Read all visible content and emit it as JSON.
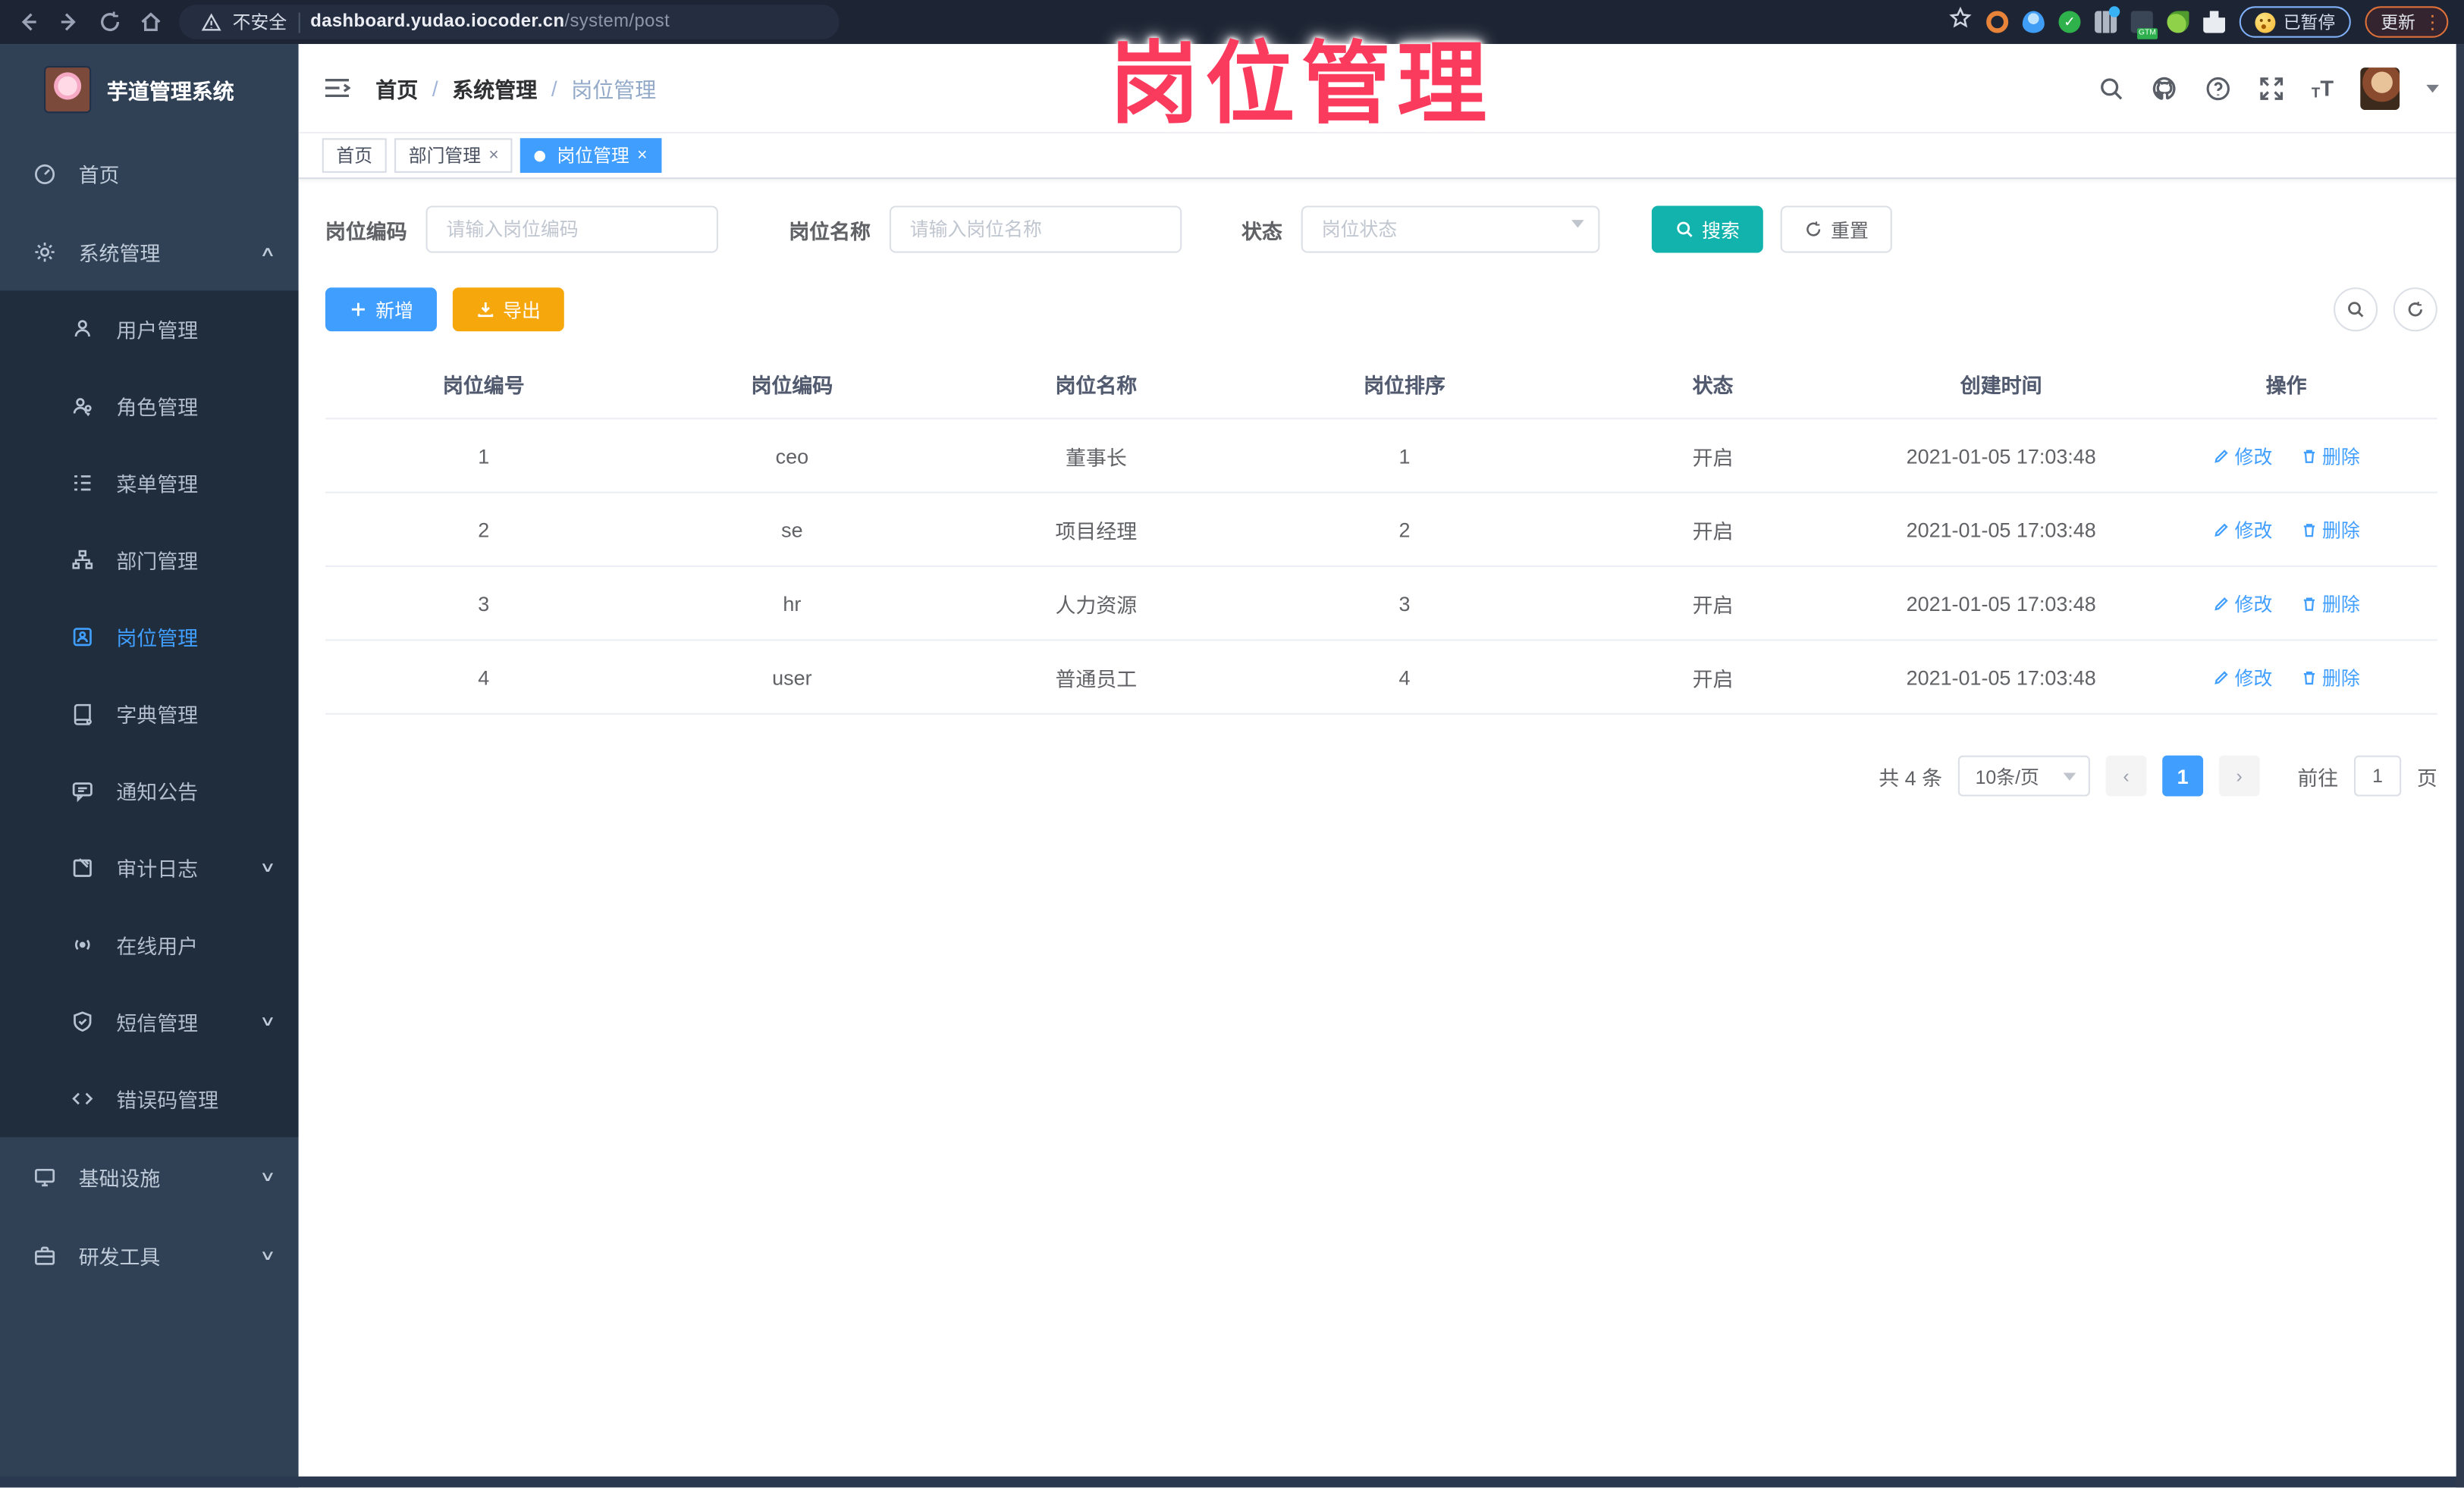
{
  "browser": {
    "security_label": "不安全",
    "url_host": "dashboard.yudao.iocoder.cn",
    "url_path": "/system/post",
    "paused_badge": "已暂停",
    "update_button": "更新"
  },
  "watermark": "岗位管理",
  "sidebar": {
    "app_title": "芋道管理系统",
    "items": [
      {
        "label": "首页"
      },
      {
        "label": "系统管理"
      },
      {
        "label": "用户管理"
      },
      {
        "label": "角色管理"
      },
      {
        "label": "菜单管理"
      },
      {
        "label": "部门管理"
      },
      {
        "label": "岗位管理"
      },
      {
        "label": "字典管理"
      },
      {
        "label": "通知公告"
      },
      {
        "label": "审计日志"
      },
      {
        "label": "在线用户"
      },
      {
        "label": "短信管理"
      },
      {
        "label": "错误码管理"
      },
      {
        "label": "基础设施"
      },
      {
        "label": "研发工具"
      }
    ]
  },
  "breadcrumb": {
    "home": "首页",
    "section": "系统管理",
    "current": "岗位管理",
    "separator": "/"
  },
  "tabs": [
    {
      "label": "首页"
    },
    {
      "label": "部门管理",
      "close": "×"
    },
    {
      "label": "岗位管理",
      "close": "×"
    }
  ],
  "filters": {
    "code_label": "岗位编码",
    "code_placeholder": "请输入岗位编码",
    "name_label": "岗位名称",
    "name_placeholder": "请输入岗位名称",
    "status_label": "状态",
    "status_placeholder": "岗位状态",
    "search_label": "搜索",
    "reset_label": "重置"
  },
  "toolbar": {
    "add_label": "新增",
    "export_label": "导出"
  },
  "table": {
    "columns": [
      "岗位编号",
      "岗位编码",
      "岗位名称",
      "岗位排序",
      "状态",
      "创建时间",
      "操作"
    ],
    "edit_label": "修改",
    "delete_label": "删除",
    "rows": [
      {
        "id": "1",
        "code": "ceo",
        "name": "董事长",
        "sort": "1",
        "status": "开启",
        "created": "2021-01-05 17:03:48"
      },
      {
        "id": "2",
        "code": "se",
        "name": "项目经理",
        "sort": "2",
        "status": "开启",
        "created": "2021-01-05 17:03:48"
      },
      {
        "id": "3",
        "code": "hr",
        "name": "人力资源",
        "sort": "3",
        "status": "开启",
        "created": "2021-01-05 17:03:48"
      },
      {
        "id": "4",
        "code": "user",
        "name": "普通员工",
        "sort": "4",
        "status": "开启",
        "created": "2021-01-05 17:03:48"
      }
    ]
  },
  "pagination": {
    "total_text": "共 4 条",
    "page_size": "10条/页",
    "prev": "‹",
    "next": "›",
    "current_page": "1",
    "goto_label": "前往",
    "goto_value": "1",
    "page_unit": "页"
  },
  "colors": {
    "accent": "#409eff",
    "search": "#12b3ad",
    "export": "#f5a70c",
    "annotation": "#fb3b5d"
  }
}
